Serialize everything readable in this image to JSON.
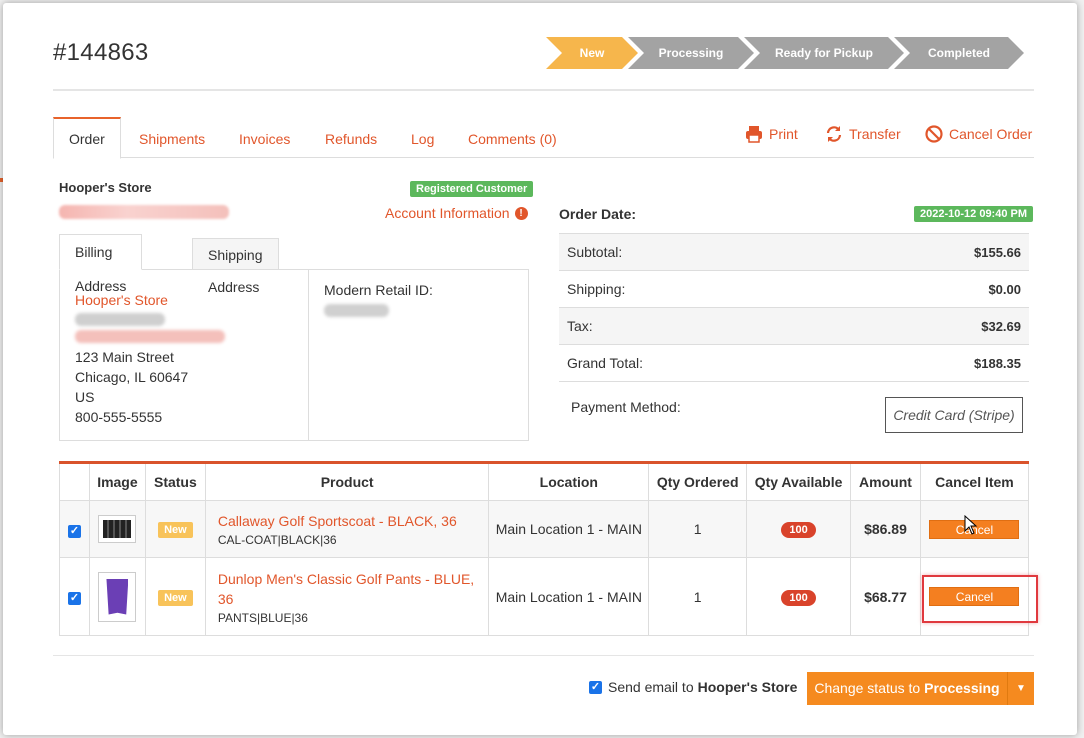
{
  "order": {
    "number": "#144863"
  },
  "steps": [
    "New",
    "Processing",
    "Ready for Pickup",
    "Completed"
  ],
  "tabs": [
    "Order",
    "Shipments",
    "Invoices",
    "Refunds",
    "Log",
    "Comments (0)"
  ],
  "actions": {
    "print": "Print",
    "transfer": "Transfer",
    "cancel_order": "Cancel Order"
  },
  "customer": {
    "name": "Hooper's Store",
    "badge": "Registered Customer",
    "account_info": "Account Information"
  },
  "address_tabs": [
    "Billing Address",
    "Shipping Address"
  ],
  "address": {
    "store": "Hooper's Store",
    "street": "123 Main Street",
    "city": "Chicago, IL 60647",
    "country": "US",
    "phone": "800-555-5555",
    "retail_id_label": "Modern Retail ID:"
  },
  "order_date": {
    "label": "Order Date:",
    "value": "2022-10-12 09:40 PM"
  },
  "totals": [
    {
      "label": "Subtotal:",
      "value": "$155.66"
    },
    {
      "label": "Shipping:",
      "value": "$0.00"
    },
    {
      "label": "Tax:",
      "value": "$32.69"
    },
    {
      "label": "Grand Total:",
      "value": "$188.35"
    }
  ],
  "payment": {
    "label": "Payment Method:",
    "value": "Credit Card (Stripe)"
  },
  "items_table": {
    "headers": [
      "Image",
      "Status",
      "Product",
      "Location",
      "Qty Ordered",
      "Qty Available",
      "Amount",
      "Cancel Item"
    ],
    "rows": [
      {
        "status": "New",
        "product": "Callaway Golf Sportscoat - BLACK, 36",
        "sku": "CAL-COAT|BLACK|36",
        "location": "Main Location 1 - MAIN",
        "qty_ordered": "1",
        "qty_available": "100",
        "amount": "$86.89",
        "cancel": "Cancel"
      },
      {
        "status": "New",
        "product": "Dunlop Men's Classic Golf Pants - BLUE, 36",
        "sku": "PANTS|BLUE|36",
        "location": "Main Location 1 - MAIN",
        "qty_ordered": "1",
        "qty_available": "100",
        "amount": "$68.77",
        "cancel": "Cancel"
      }
    ]
  },
  "footer": {
    "send_email_prefix": "Send email to",
    "send_email_name": "Hooper's Store",
    "status_prefix": "Change status to",
    "status_target": "Processing"
  },
  "colors": {
    "accent": "#e1562b",
    "button": "#f58a1f",
    "step_active": "#f6b64c",
    "step_inactive": "#a3a3a3",
    "badge_green": "#5cb85c"
  }
}
